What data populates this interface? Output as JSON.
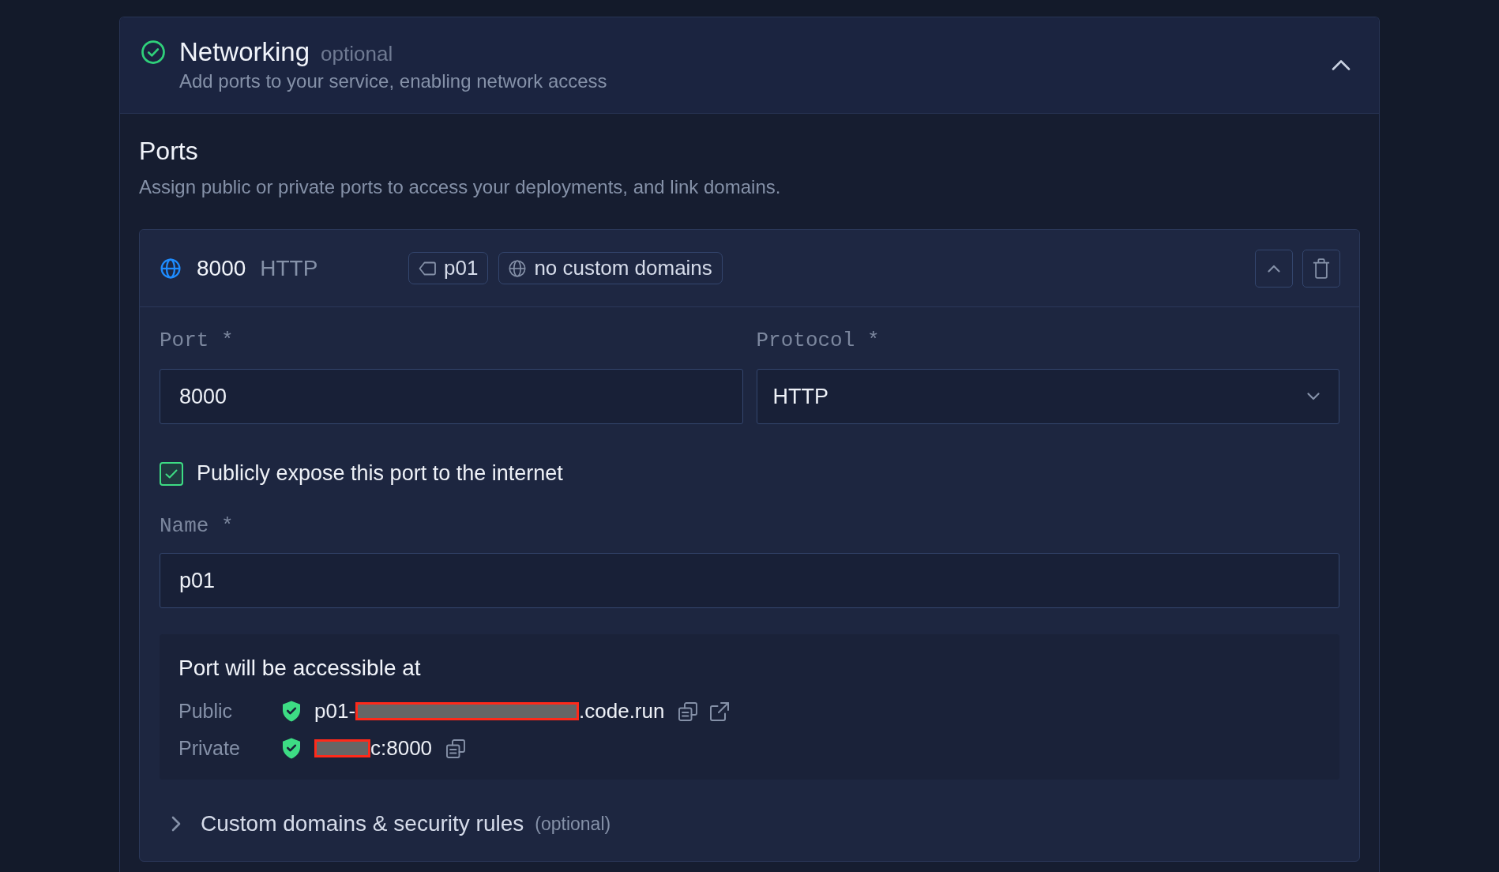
{
  "section": {
    "title": "Networking",
    "badge": "optional",
    "subtitle": "Add ports to your service, enabling network access",
    "complete": true,
    "expanded": true
  },
  "ports": {
    "title": "Ports",
    "description": "Assign public or private ports to access your deployments, and link domains.",
    "items": [
      {
        "port": "8000",
        "protocol": "HTTP",
        "tag": "p01",
        "domains": "no custom domains",
        "expanded": true,
        "fields": [
          {
            "kind": "text",
            "label": "Port *",
            "value": "8000"
          },
          {
            "kind": "select",
            "label": "Protocol *",
            "value": "HTTP"
          }
        ],
        "expose": {
          "label": "Publicly expose this port to the internet",
          "checked": true
        },
        "name_field": {
          "label": "Name *",
          "value": "p01"
        },
        "access": {
          "title": "Port will be accessible at",
          "rows": [
            {
              "label": "Public",
              "secure": true,
              "prefix": "p01-",
              "redacted": true,
              "suffix": ".code.run",
              "actions": [
                {
                  "kind": "copy"
                },
                {
                  "kind": "open"
                }
              ]
            },
            {
              "label": "Private",
              "secure": true,
              "redacted": true,
              "suffix": "c:8000",
              "actions": [
                {
                  "kind": "copy"
                }
              ]
            }
          ]
        },
        "advanced": {
          "label": "Custom domains & security rules",
          "note": "(optional)",
          "expanded": false
        }
      }
    ]
  }
}
